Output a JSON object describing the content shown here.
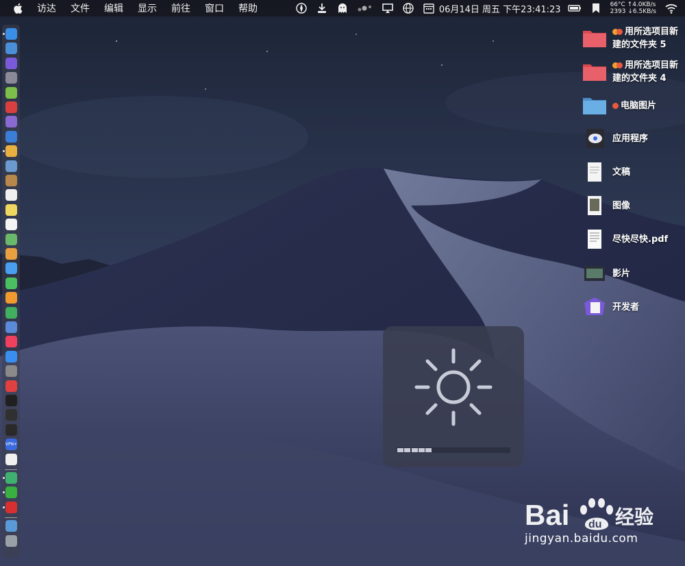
{
  "menubar": {
    "items": [
      "访达",
      "文件",
      "编辑",
      "显示",
      "前往",
      "窗口",
      "帮助"
    ],
    "clock": "06月14日 周五 下午23:41:23",
    "netstat_line1": "66°C ↑4.0KB/s",
    "netstat_line2": "2393 ↓6.5KB/s",
    "status_icons": [
      "compass-icon",
      "download-icon",
      "ghost-icon",
      "dots-icon",
      "display-icon",
      "globe-icon",
      "calendar-icon",
      "battery-icon",
      "bookmark-icon",
      "wifi-icon"
    ]
  },
  "desktop": {
    "items": [
      {
        "name": "folder-5",
        "line1": "用所选项目新",
        "line2": "建的文件夹 5",
        "tags": [
          "#f0a030",
          "#e85a40"
        ],
        "icon": "red-folder-icon"
      },
      {
        "name": "folder-4",
        "line1": "用所选项目新",
        "line2": "建的文件夹 4",
        "tags": [
          "#f0a030",
          "#e85a40"
        ],
        "icon": "red-folder-icon"
      },
      {
        "name": "computer-pictures",
        "line1": "电脑图片",
        "line2": "",
        "tags": [
          "#e85a40"
        ],
        "icon": "blue-folder-icon"
      },
      {
        "name": "applications",
        "line1": "应用程序",
        "line2": "",
        "tags": [],
        "icon": "applications-icon"
      },
      {
        "name": "documents",
        "line1": "文稿",
        "line2": "",
        "tags": [],
        "icon": "document-icon"
      },
      {
        "name": "images",
        "line1": "图像",
        "line2": "",
        "tags": [],
        "icon": "image-icon"
      },
      {
        "name": "pdf",
        "line1": "尽快尽快.pdf",
        "line2": "",
        "tags": [],
        "icon": "pdf-icon"
      },
      {
        "name": "movies",
        "line1": "影片",
        "line2": "",
        "tags": [],
        "icon": "movie-icon"
      },
      {
        "name": "developer",
        "line1": "开发者",
        "line2": "",
        "tags": [],
        "icon": "developer-icon"
      }
    ]
  },
  "dock": {
    "apps": [
      {
        "name": "finder",
        "color": "#3a8ee6",
        "running": true
      },
      {
        "name": "safari-compass",
        "color": "#4a8fd8",
        "running": false
      },
      {
        "name": "siri",
        "color": "#7a5ad8",
        "running": false
      },
      {
        "name": "launchpad",
        "color": "#8a8a9a",
        "running": false
      },
      {
        "name": "android",
        "color": "#7cc04a",
        "running": false
      },
      {
        "name": "app-red",
        "color": "#d84040",
        "running": false
      },
      {
        "name": "app-purple",
        "color": "#8a6ad0",
        "running": false
      },
      {
        "name": "xcode",
        "color": "#3a7ed6",
        "running": false
      },
      {
        "name": "chrome",
        "color": "#e8b040",
        "running": true
      },
      {
        "name": "preview",
        "color": "#6a9ad0",
        "running": false
      },
      {
        "name": "notes-brown",
        "color": "#b8884a",
        "running": false
      },
      {
        "name": "calendar",
        "color": "#f0f0f0",
        "running": false
      },
      {
        "name": "notes",
        "color": "#f0d860",
        "running": false
      },
      {
        "name": "reminders",
        "color": "#f4f4f4",
        "running": false
      },
      {
        "name": "maps",
        "color": "#6ab86a",
        "running": false
      },
      {
        "name": "photos",
        "color": "#e8a040",
        "running": false
      },
      {
        "name": "messages",
        "color": "#4a9ef0",
        "running": false
      },
      {
        "name": "facetime",
        "color": "#4ac060",
        "running": false
      },
      {
        "name": "pages",
        "color": "#f09a30",
        "running": false
      },
      {
        "name": "numbers",
        "color": "#40b060",
        "running": false
      },
      {
        "name": "keynote",
        "color": "#5a8ad8",
        "running": false
      },
      {
        "name": "music",
        "color": "#f04060",
        "running": false
      },
      {
        "name": "app-store",
        "color": "#3a8ef0",
        "running": false
      },
      {
        "name": "system-preferences",
        "color": "#8a8a8a",
        "running": false
      },
      {
        "name": "vivaldi",
        "color": "#e04040",
        "running": false
      },
      {
        "name": "terminal",
        "color": "#202020",
        "running": false
      },
      {
        "name": "activity-monitor",
        "color": "#303030",
        "running": false
      },
      {
        "name": "console",
        "color": "#2a2a2a",
        "running": false
      },
      {
        "name": "vpn",
        "color": "#3a6ae0",
        "running": false
      },
      {
        "name": "yandex",
        "color": "#f0f0f0",
        "running": false
      },
      {
        "name": "app-green",
        "color": "#40b070",
        "running": true
      },
      {
        "name": "wechat",
        "color": "#3ab040",
        "running": true
      },
      {
        "name": "netease-music",
        "color": "#d83030",
        "running": true
      },
      {
        "name": "downloads-folder",
        "color": "#5a9ad8",
        "running": false
      },
      {
        "name": "trash",
        "color": "#9aa0a8",
        "running": false
      }
    ],
    "vpn_label": "VPN+"
  },
  "hud": {
    "level": 0.3,
    "segments_total": 16,
    "segments_filled": 5
  },
  "watermark": {
    "brand": "Bai",
    "paw_text": "du",
    "jingyan": "经验",
    "url": "jingyan.baidu.com"
  },
  "colors": {
    "menubar_bg": "#16181f",
    "accent_red_folder": "#e8505a",
    "blue_folder": "#6aaee6"
  }
}
